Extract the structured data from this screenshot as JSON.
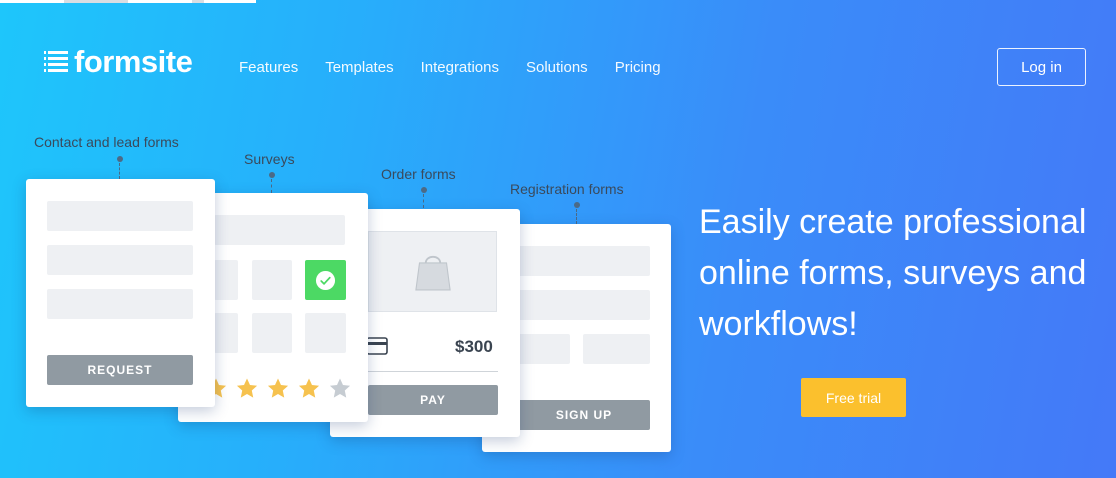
{
  "brand": {
    "name": "formsite"
  },
  "nav": {
    "items": [
      {
        "label": "Features"
      },
      {
        "label": "Templates"
      },
      {
        "label": "Integrations"
      },
      {
        "label": "Solutions"
      },
      {
        "label": "Pricing"
      }
    ],
    "login_label": "Log in"
  },
  "showcase": {
    "contact": {
      "label": "Contact and lead forms",
      "button": "REQUEST"
    },
    "surveys": {
      "label": "Surveys",
      "rating": 4,
      "rating_max": 5
    },
    "order": {
      "label": "Order forms",
      "price": "$300",
      "button": "PAY"
    },
    "registration": {
      "label": "Registration forms",
      "button": "SIGN UP"
    }
  },
  "hero": {
    "headline_line1": "Easily create professional",
    "headline_line2": "online forms, surveys and",
    "headline_line3": "workflows!",
    "cta_label": "Free trial"
  },
  "colors": {
    "gradient_start": "#1ec6fb",
    "gradient_end": "#4479f8",
    "cta": "#fbc02d",
    "check": "#4cd964",
    "star_filled": "#f6c24f",
    "star_empty": "#c6ccd2"
  }
}
